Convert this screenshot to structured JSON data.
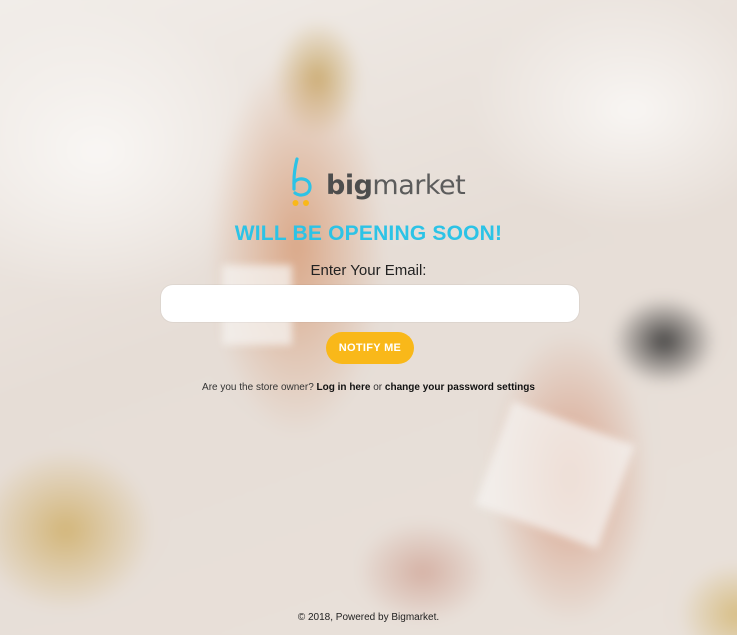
{
  "brand": {
    "name_bold": "big",
    "name_light": "market",
    "accent_color": "#2cc3e6",
    "button_color": "#f9b819",
    "logo_icon": "bigmarket-logo-icon"
  },
  "main": {
    "headline": "WILL BE OPENING SOON!",
    "email_label": "Enter Your Email:",
    "email_value": "",
    "email_placeholder": "",
    "notify_button": "NOTIFY ME"
  },
  "owner_prompt": {
    "question": "Are you the store owner?",
    "login_link": "Log in here",
    "separator": "or",
    "password_link": "change your password settings"
  },
  "footer": {
    "text": "© 2018, Powered by Bigmarket."
  }
}
